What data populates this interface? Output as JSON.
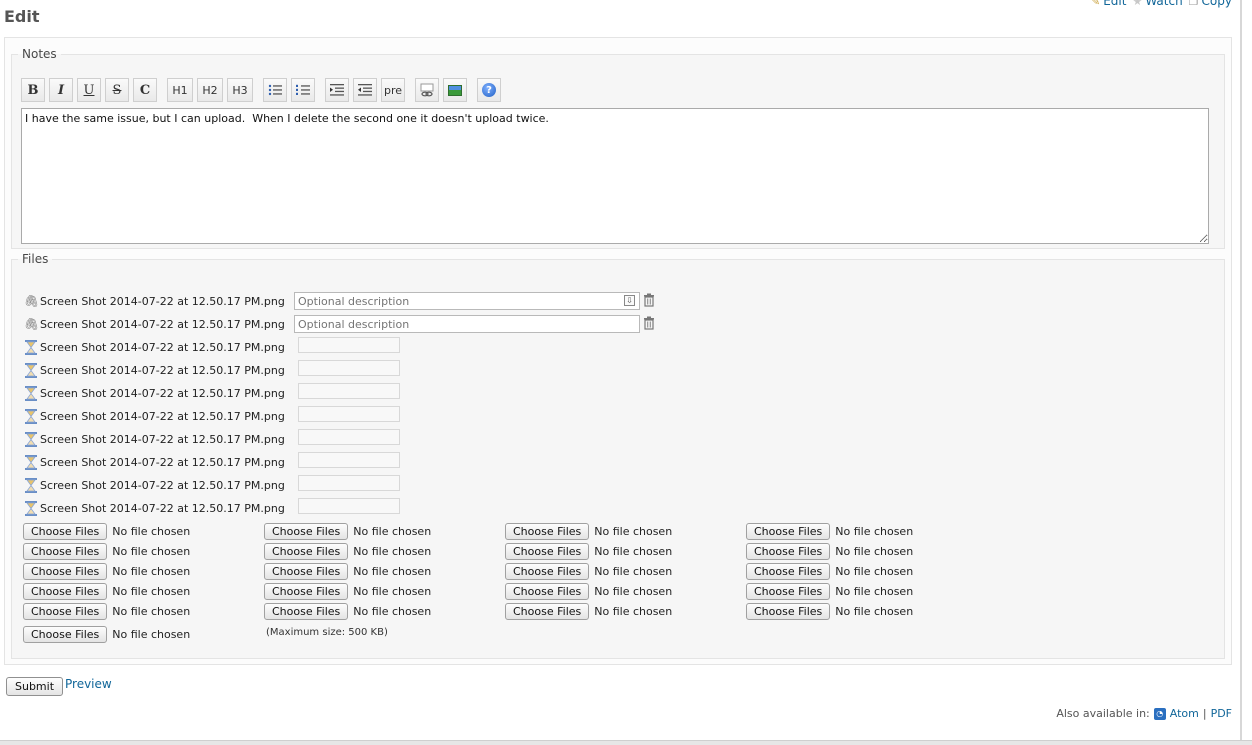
{
  "header": {
    "title": "Edit",
    "actions": [
      {
        "label": "Edit",
        "icon": "pencil-icon"
      },
      {
        "label": "Watch",
        "icon": "star-icon"
      },
      {
        "label": "Copy",
        "icon": "copy-icon"
      }
    ]
  },
  "notes": {
    "legend": "Notes",
    "toolbar": {
      "bold": "B",
      "italic": "I",
      "underline": "U",
      "strike": "S",
      "code": "C",
      "h1": "H1",
      "h2": "H2",
      "h3": "H3",
      "pre": "pre"
    },
    "text": "I have the same issue, but I can upload.  When I delete the second one it doesn't upload twice."
  },
  "files": {
    "legend": "Files",
    "attached": [
      {
        "name": "Screen Shot 2014-07-22 at 12.50.17 PM.png",
        "status": "attached",
        "placeholder": "Optional description"
      },
      {
        "name": "Screen Shot 2014-07-22 at 12.50.17 PM.png",
        "status": "attached",
        "placeholder": "Optional description"
      },
      {
        "name": "Screen Shot 2014-07-22 at 12.50.17 PM.png",
        "status": "pending"
      },
      {
        "name": "Screen Shot 2014-07-22 at 12.50.17 PM.png",
        "status": "pending"
      },
      {
        "name": "Screen Shot 2014-07-22 at 12.50.17 PM.png",
        "status": "pending"
      },
      {
        "name": "Screen Shot 2014-07-22 at 12.50.17 PM.png",
        "status": "pending"
      },
      {
        "name": "Screen Shot 2014-07-22 at 12.50.17 PM.png",
        "status": "pending"
      },
      {
        "name": "Screen Shot 2014-07-22 at 12.50.17 PM.png",
        "status": "pending"
      },
      {
        "name": "Screen Shot 2014-07-22 at 12.50.17 PM.png",
        "status": "pending"
      },
      {
        "name": "Screen Shot 2014-07-22 at 12.50.17 PM.png",
        "status": "pending"
      }
    ],
    "choose_label": "Choose Files",
    "no_file_label": "No file chosen",
    "choose_count": 21,
    "max_size": "(Maximum size: 500 KB)"
  },
  "form": {
    "submit": "Submit",
    "preview": "Preview"
  },
  "footer": {
    "also_available": "Also available in:",
    "atom": "Atom",
    "separator": "|",
    "pdf": "PDF"
  }
}
